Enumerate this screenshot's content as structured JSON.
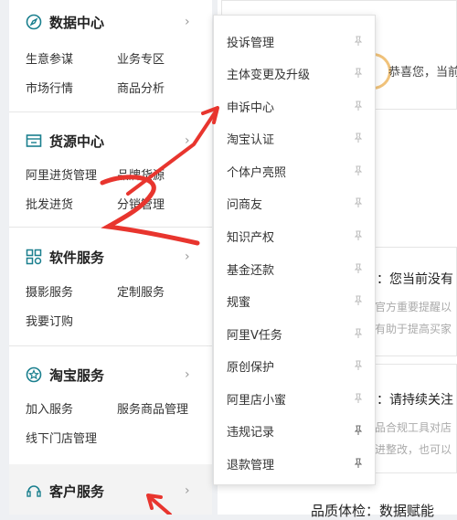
{
  "sidebar": {
    "sections": [
      {
        "title": "数据中心",
        "icon": "data-compass-icon",
        "links": [
          "生意参谋",
          "业务专区",
          "市场行情",
          "商品分析"
        ]
      },
      {
        "title": "货源中心",
        "icon": "supply-box-icon",
        "links": [
          "阿里进货管理",
          "品牌货源",
          "批发进货",
          "分销管理"
        ]
      },
      {
        "title": "软件服务",
        "icon": "grid-apps-icon",
        "links": [
          "摄影服务",
          "定制服务",
          "我要订购"
        ]
      },
      {
        "title": "淘宝服务",
        "icon": "star-badge-icon",
        "links": [
          "加入服务",
          "服务商品管理",
          "线下门店管理"
        ]
      },
      {
        "title": "客户服务",
        "icon": "headset-icon",
        "links": []
      }
    ],
    "chevron": "›"
  },
  "dropdown": {
    "items": [
      "投诉管理",
      "主体变更及升级",
      "申诉中心",
      "淘宝认证",
      "个体户亮照",
      "问商友",
      "知识产权",
      "基金还款",
      "规蜜",
      "阿里V任务",
      "原创保护",
      "阿里店小蜜",
      "违规记录",
      "退款管理"
    ]
  },
  "main": {
    "congrats": "恭喜您，当前",
    "notices": [
      {
        "title": "：您当前没有",
        "line1": "官方重要提醒以",
        "line2": "有助于提高买家"
      },
      {
        "title": "：请持续关注",
        "line1": "品合规工具对店",
        "line2": "进整改，也可以"
      }
    ],
    "bottom": "品质体检：数据赋能"
  },
  "colors": {
    "annotation": "#e8352e",
    "accent": "#1a7f8e"
  }
}
